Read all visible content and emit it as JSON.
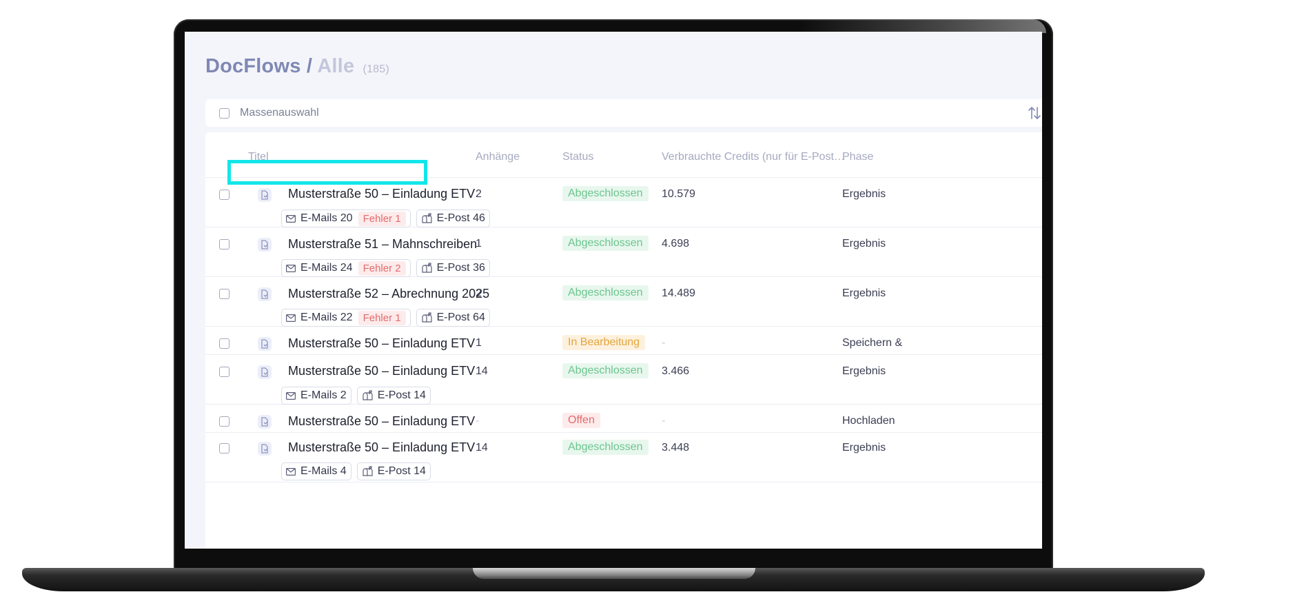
{
  "header": {
    "title": "DocFlows",
    "separator": "/",
    "view": "Alle",
    "count": "(185)"
  },
  "mass_select": {
    "label": "Massenauswahl"
  },
  "columns": {
    "title": "Titel",
    "attachments": "Anhänge",
    "status": "Status",
    "credits": "Verbrauchte Credits (nur für E-Post…",
    "phase": "Phase"
  },
  "rows": [
    {
      "title": "Musterstraße 50 – Einladung  ETV",
      "emails": "E-Mails 20",
      "error": "Fehler 1",
      "epost": "E-Post 46",
      "attachments": "2",
      "status": "Abgeschlossen",
      "credits": "10.579",
      "phase": "Ergebnis"
    },
    {
      "title": "Musterstraße 51 – Mahnschreiben",
      "emails": "E-Mails 24",
      "error": "Fehler 2",
      "epost": "E-Post 36",
      "attachments": "1",
      "status": "Abgeschlossen",
      "credits": "4.698",
      "phase": "Ergebnis"
    },
    {
      "title": "Musterstraße 52 – Abrechnung 2025",
      "emails": "E-Mails 22",
      "error": "Fehler 1",
      "epost": "E-Post 64",
      "attachments": "2",
      "status": "Abgeschlossen",
      "credits": "14.489",
      "phase": "Ergebnis"
    },
    {
      "title": "Musterstraße 50 – Einladung  ETV",
      "attachments": "1",
      "status": "In Bearbeitung",
      "credits": "-",
      "phase": "Speichern &"
    },
    {
      "title": "Musterstraße 50 – Einladung  ETV",
      "emails": "E-Mails 2",
      "epost": "E-Post 14",
      "attachments": "14",
      "status": "Abgeschlossen",
      "credits": "3.466",
      "phase": "Ergebnis"
    },
    {
      "title": "Musterstraße 50 – Einladung  ETV",
      "attachments": "-",
      "status": "Offen",
      "credits": "-",
      "phase": "Hochladen"
    },
    {
      "title": "Musterstraße 50 – Einladung  ETV",
      "emails": "E-Mails 4",
      "epost": "E-Post 14",
      "attachments": "14",
      "status": "Abgeschlossen",
      "credits": "3.448",
      "phase": "Ergebnis"
    }
  ],
  "colors": {
    "highlight": "#12e6ea",
    "status_done": "#6cc58e",
    "status_in_progress": "#e4a53e",
    "status_open": "#e46a6a"
  },
  "icons": [
    "doc-flow-icon",
    "mail-icon",
    "mailbox-icon",
    "sort-icon"
  ]
}
